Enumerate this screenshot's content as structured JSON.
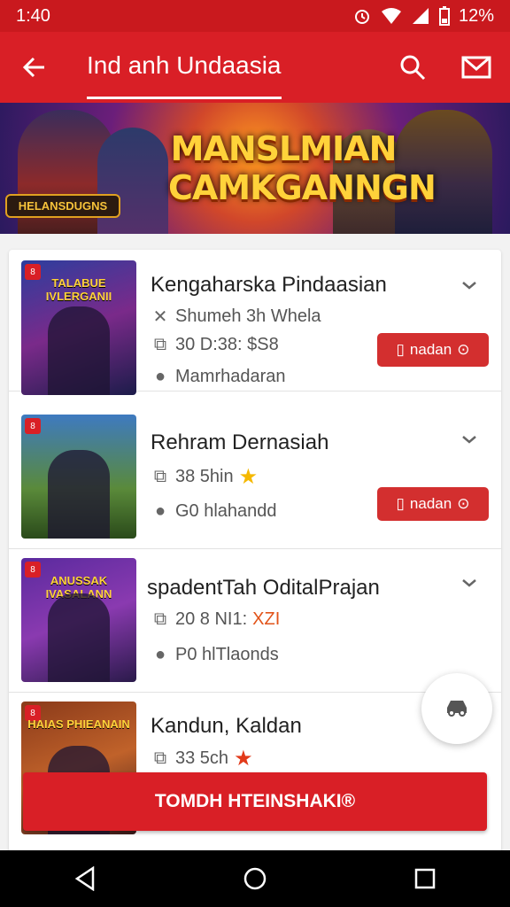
{
  "status": {
    "time": "1:40",
    "battery": "12%"
  },
  "app_bar": {
    "title": "Ind anh Undaasia"
  },
  "banner": {
    "headline": "MANSLMIAN CAMKGANNGN",
    "badge": "HELANSDUGNS"
  },
  "items": [
    {
      "thumb_title": "TALABUE IVLERGANII",
      "name": "Kengaharska Pindaasian",
      "line1": "Shumeh 3h Whela",
      "line2": "30 D:38: $S8",
      "line3": "Mamrhadaran",
      "button": "nadan"
    },
    {
      "thumb_title": "",
      "name": "Rehram Dernasiah",
      "line1": "38 5hin",
      "line2": "G0 hlahandd",
      "button": "nadan"
    },
    {
      "thumb_title": "ANUSSAK IVASALANN",
      "name": "spadentTah OditalPrajan",
      "line1": "20 8 NI1:",
      "line1_suffix": "XZI",
      "line2": "P0 hlTlaonds"
    },
    {
      "thumb_title": "HAIAS PHIEANAIN",
      "name": "Kandun, Kaldan",
      "line1": "33 5ch"
    }
  ],
  "cta": {
    "label": "TOMDH HTEINSHAKI®"
  },
  "colors": {
    "primary": "#d91f26",
    "status": "#c9191e",
    "button": "#d32f2f"
  }
}
